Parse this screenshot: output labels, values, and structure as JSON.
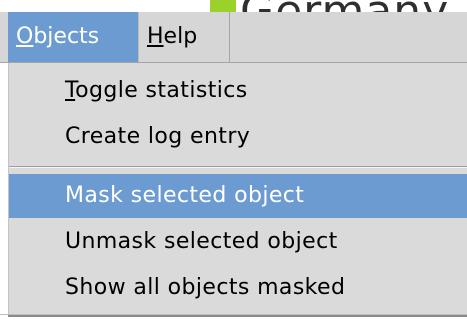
{
  "background_window": {
    "title_fragment": "Germany M",
    "accent_color": "#9bd12a"
  },
  "menubar": {
    "menus": [
      {
        "label_underlined": "O",
        "label_rest": "bjects",
        "state": "open"
      },
      {
        "label_underlined": "H",
        "label_rest": "elp",
        "state": "closed"
      }
    ]
  },
  "dropdown": {
    "items": [
      {
        "label_underlined": "T",
        "label_rest": "oggle statistics",
        "selected": false
      },
      {
        "label": "Create log entry",
        "selected": false
      },
      {
        "label": "Mask selected object",
        "selected": true
      },
      {
        "label": "Unmask selected object",
        "selected": false
      },
      {
        "label": "Show all objects masked",
        "selected": false
      }
    ]
  },
  "colors": {
    "selection": "#6c9bd2",
    "menu_background": "#dadada",
    "menubar_background": "#d6d6d6"
  }
}
